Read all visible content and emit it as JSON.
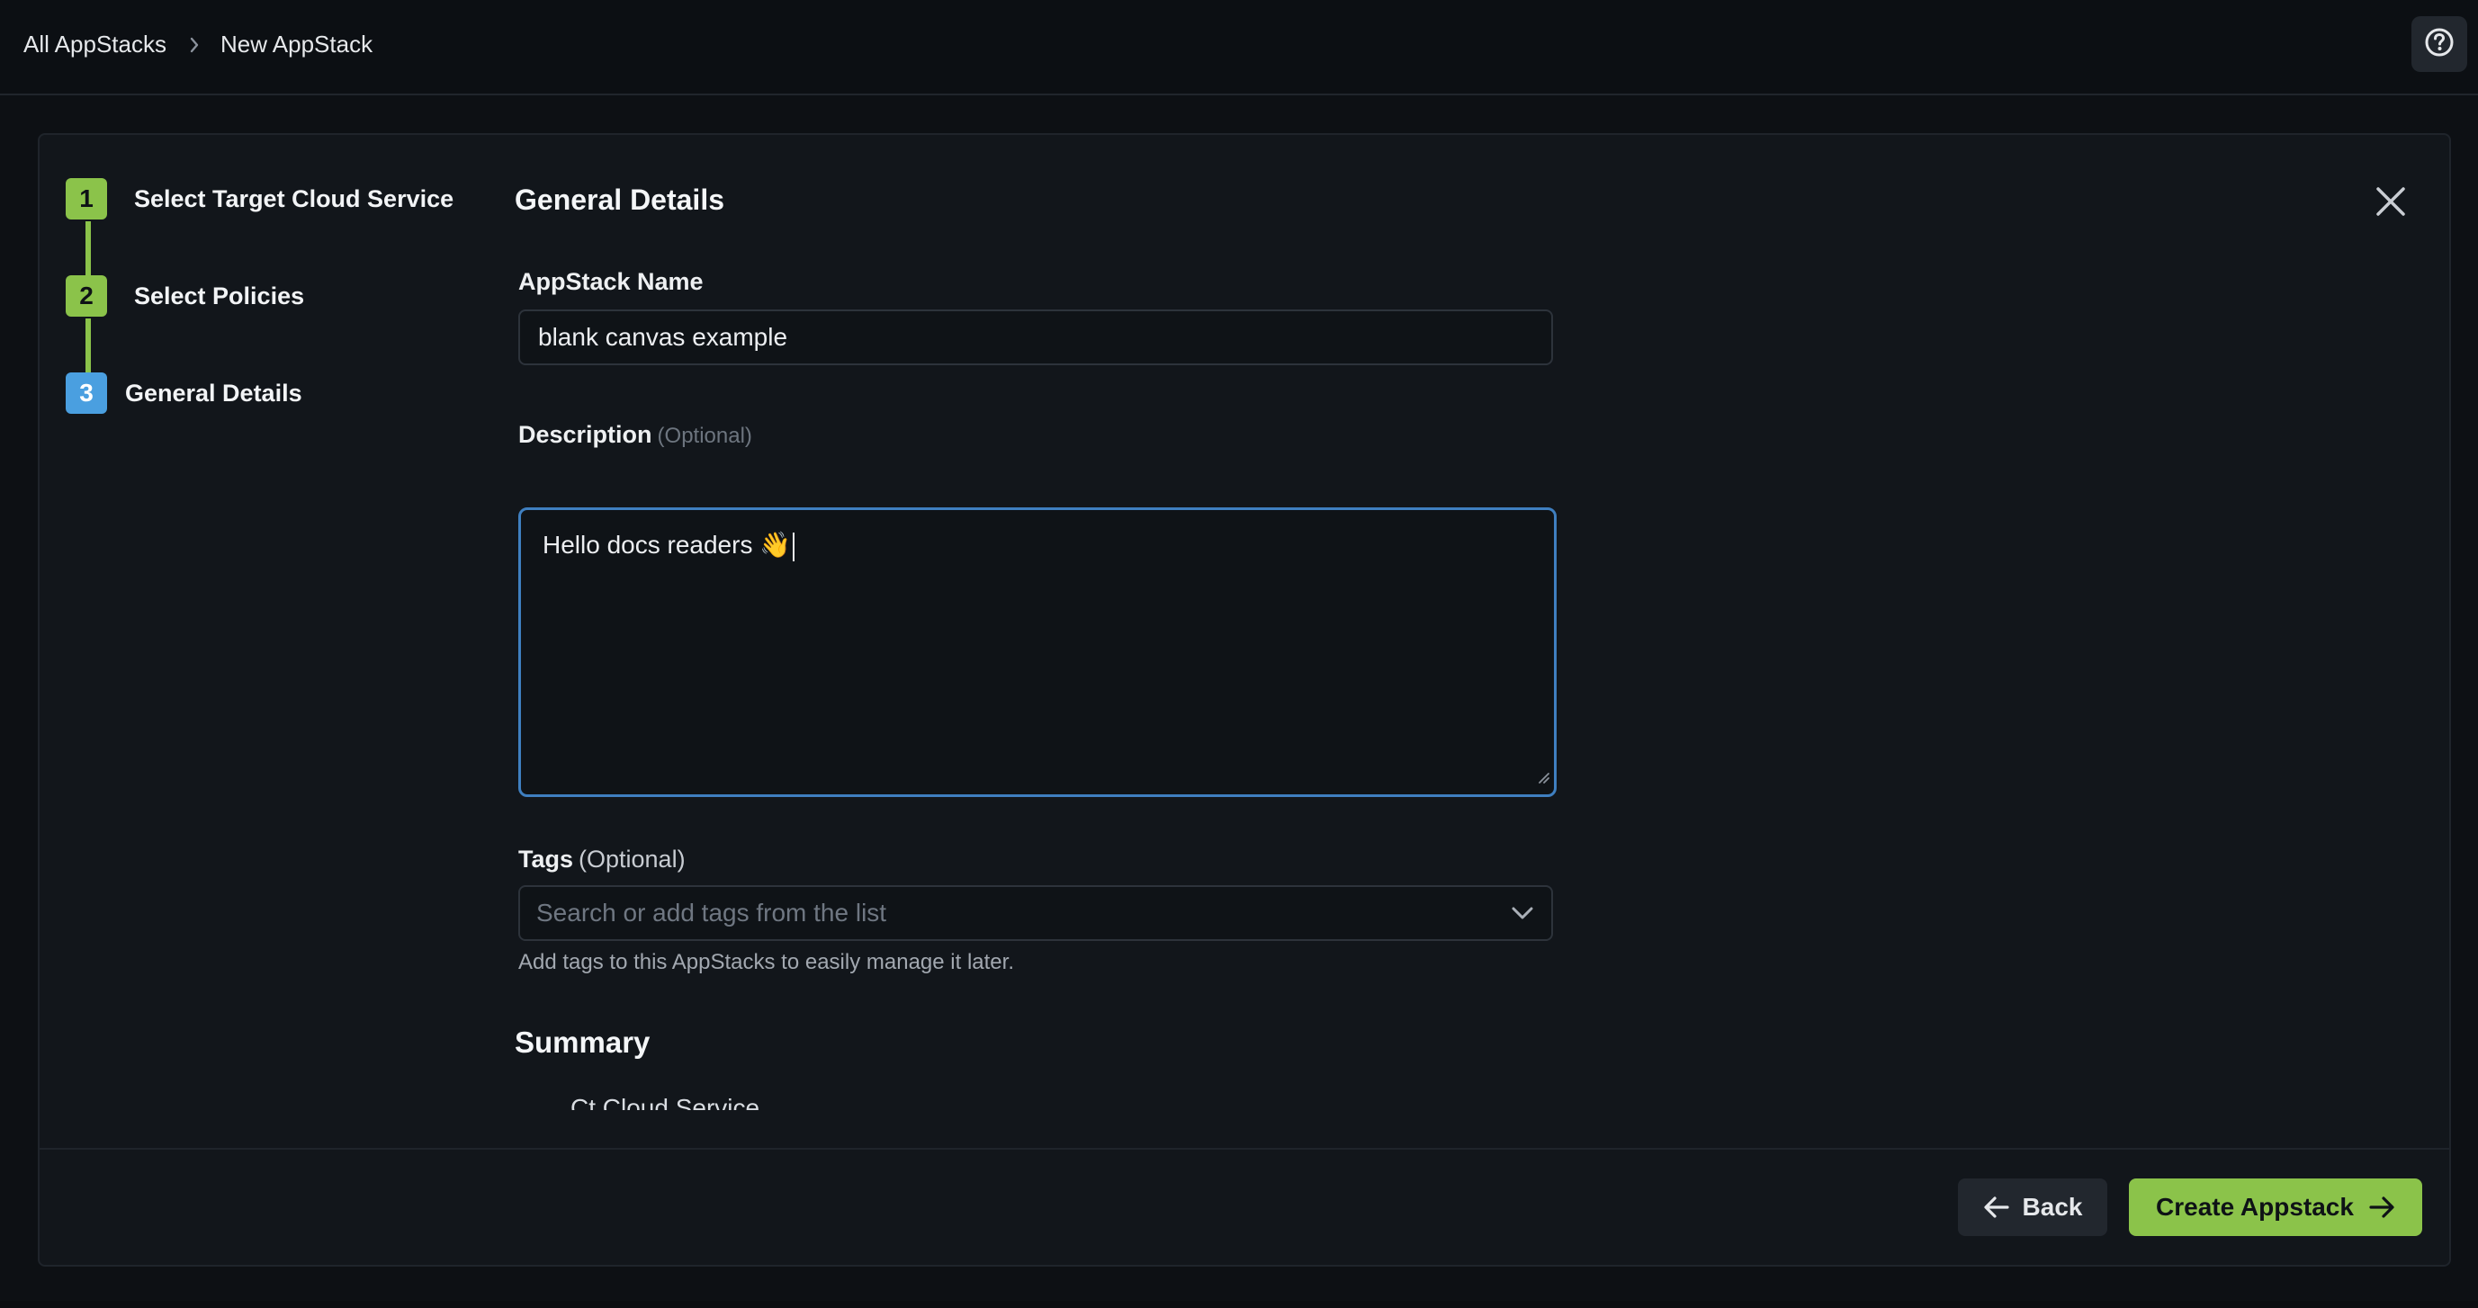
{
  "breadcrumb": {
    "root": "All AppStacks",
    "current": "New AppStack"
  },
  "icons": {
    "help": "question-circle-icon",
    "separator": "chevron-right-icon",
    "close": "close-icon",
    "dropdown": "chevron-down-icon",
    "back": "arrow-left-icon",
    "forward": "arrow-right-icon"
  },
  "colors": {
    "accent_green": "#8bc34a",
    "active_blue": "#4a9fe0",
    "focus_border": "#3f7fc0",
    "background": "#0d1014",
    "panel": "#12161b"
  },
  "stepper": {
    "steps": [
      {
        "number": "1",
        "label": "Select Target Cloud Service",
        "state": "done"
      },
      {
        "number": "2",
        "label": "Select Policies",
        "state": "done"
      },
      {
        "number": "3",
        "label": "General Details",
        "state": "active"
      }
    ]
  },
  "form": {
    "title": "General Details",
    "name_label": "AppStack Name",
    "name_value": "blank canvas example",
    "description_label": "Description",
    "description_optional": "(Optional)",
    "description_value": "Hello docs readers 👋",
    "tags_label": "Tags",
    "tags_optional": "(Optional)",
    "tags_placeholder": "Search or add tags from the list",
    "tags_hint": "Add tags to this AppStacks to easily manage it later."
  },
  "summary": {
    "title": "Summary",
    "first_item_partial": "Ct Cloud Service"
  },
  "footer": {
    "back_label": "Back",
    "create_label": "Create Appstack"
  }
}
